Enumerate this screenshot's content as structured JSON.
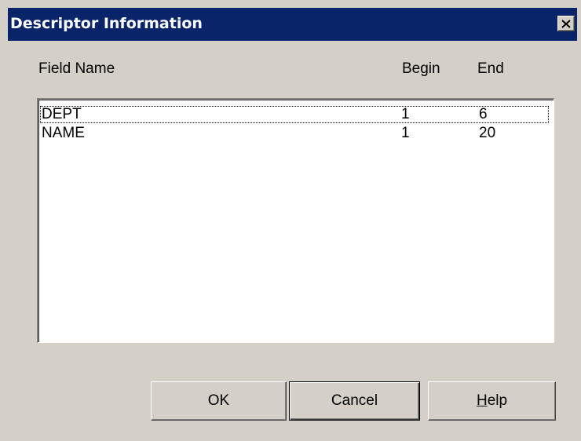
{
  "dialog": {
    "title": "Descriptor Information",
    "colors": {
      "titlebar": "#0a246a",
      "face": "#d4d0c8",
      "list_bg": "#ffffff"
    }
  },
  "columns": {
    "field_name": "Field Name",
    "begin": "Begin",
    "end": "End"
  },
  "rows": [
    {
      "field": "DEPT",
      "begin": "1",
      "end": "6",
      "focused": true
    },
    {
      "field": "NAME",
      "begin": "1",
      "end": "20",
      "focused": false
    }
  ],
  "buttons": {
    "ok": "OK",
    "cancel": "Cancel",
    "help_mnemonic": "H",
    "help_rest": "elp"
  },
  "icons": {
    "close": "close-x-icon"
  }
}
